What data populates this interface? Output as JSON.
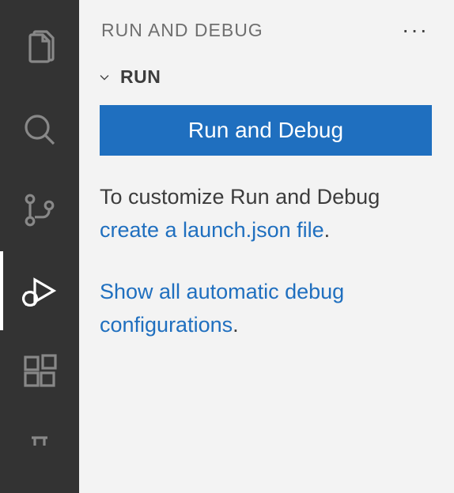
{
  "panel": {
    "title": "RUN AND DEBUG",
    "more_actions": "···"
  },
  "section": {
    "title": "RUN"
  },
  "content": {
    "run_button_label": "Run and Debug",
    "customize_prefix": "To customize Run and Debug ",
    "create_link": "create a launch.json file",
    "customize_suffix": ".",
    "show_all_link": "Show all automatic debug configurations",
    "show_all_suffix": "."
  }
}
